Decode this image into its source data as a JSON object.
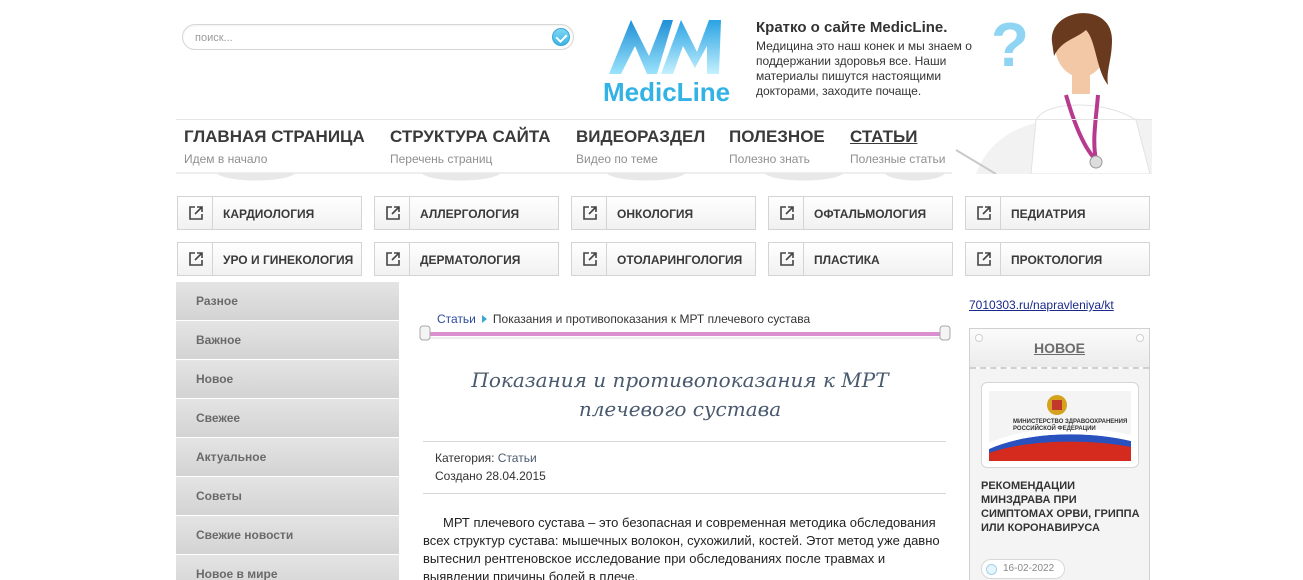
{
  "search": {
    "placeholder": "поиск..."
  },
  "logo": {
    "text": "MedicLine"
  },
  "about": {
    "title": "Кратко о сайте MedicLine.",
    "text": "Медицина это наш конек и мы знаем о поддержании здоровья все. Наши материалы пишутся настоящими докторами, заходите почаще."
  },
  "nav": [
    {
      "label": "ГЛАВНАЯ СТРАНИЦА",
      "sub": "Идем в начало"
    },
    {
      "label": "СТРУКТУРА САЙТА",
      "sub": "Перечень страниц"
    },
    {
      "label": "ВИДЕОРАЗДЕЛ",
      "sub": "Видео по теме"
    },
    {
      "label": "ПОЛЕЗНОЕ",
      "sub": "Полезно знать"
    },
    {
      "label": "СТАТЬИ",
      "sub": "Полезные статьи"
    }
  ],
  "categories": [
    "КАРДИОЛОГИЯ",
    "АЛЛЕРГОЛОГИЯ",
    "ОНКОЛОГИЯ",
    "ОФТАЛЬМОЛОГИЯ",
    "ПЕДИАТРИЯ",
    "УРО И ГИНЕКОЛОГИЯ",
    "ДЕРМАТОЛОГИЯ",
    "ОТОЛАРИНГОЛОГИЯ",
    "ПЛАСТИКА",
    "ПРОКТОЛОГИЯ"
  ],
  "sidebar": [
    "Разное",
    "Важное",
    "Новое",
    "Свежее",
    "Актуальное",
    "Советы",
    "Свежие новости",
    "Новое в мире"
  ],
  "breadcrumb": {
    "root": "Статьи",
    "current": "Показания и противопоказания к МРТ плечевого сустава"
  },
  "article": {
    "title": "Показания и противопоказания к МРТ плечевого сустава",
    "category_label": "Категория:",
    "category": "Статьи",
    "created": "Создано 28.04.2015",
    "body": "МРТ плечевого сустава – это безопасная и современная методика обследования всех структур сустава: мышечных волокон, сухожилий, костей. Этот метод уже давно вытеснил рентгеновское исследование при обследованиях после травмах и выявлении причины болей в плече."
  },
  "right": {
    "link": "7010303.ru/napravleniya/kt",
    "news_heading": "НОВОЕ",
    "news_image_caption": "МИНИСТЕРСТВО ЗДРАВООХРАНЕНИЯ РОССИЙСКОЙ ФЕДЕРАЦИИ",
    "news_title": "РЕКОМЕНДАЦИИ МИНЗДРАВА ПРИ СИМПТОМАХ ОРВИ, ГРИППА ИЛИ КОРОНАВИРУСА",
    "news_date": "16-02-2022"
  },
  "colors": {
    "accent": "#33b2e6",
    "link": "#2c4a9e",
    "sidebar_bg": "#dcdcdc",
    "slider": "#d98fd0"
  }
}
